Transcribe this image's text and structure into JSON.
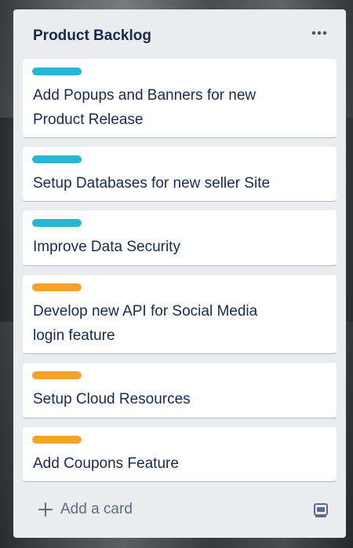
{
  "list": {
    "title": "Product Backlog",
    "menu_icon": "ellipsis-icon"
  },
  "cards": [
    {
      "title_line1": "Add Popups and Banners for new",
      "title_line2": "Product Release",
      "label_color": "#29b6d1"
    },
    {
      "title_line1": "Setup Databases for new seller Site",
      "label_color": "#29b6d1"
    },
    {
      "title_line1": "Improve Data Security",
      "label_color": "#29b6d1"
    },
    {
      "title_line1": "Develop new API for Social Media",
      "title_line2": "login feature",
      "label_color": "#f7a22b"
    },
    {
      "title_line1": "Setup Cloud Resources",
      "label_color": "#f7a22b"
    },
    {
      "title_line1": "Add Coupons Feature",
      "label_color": "#f7a22b"
    }
  ],
  "footer": {
    "add_label": "Add a card",
    "add_icon": "plus-icon",
    "template_icon": "card-template-icon"
  }
}
